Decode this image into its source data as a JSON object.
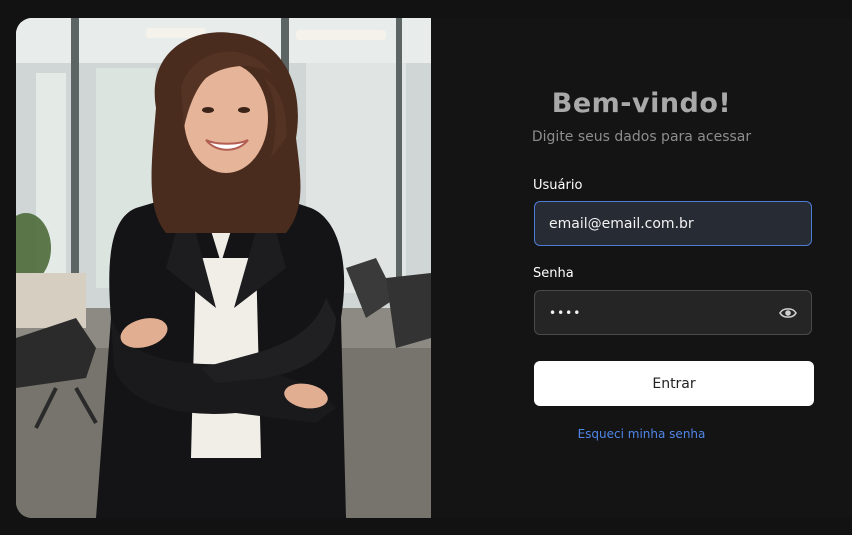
{
  "login": {
    "title": "Bem-vindo!",
    "subtitle": "Digite seus dados para acessar",
    "username_label": "Usuário",
    "username_value": "email@email.com.br",
    "password_label": "Senha",
    "password_value": "••••",
    "password_toggle_icon": "eye-icon",
    "submit_label": "Entrar",
    "forgot_label": "Esqueci minha senha"
  },
  "colors": {
    "accent": "#4f86e8",
    "background": "#141414",
    "input_background": "#252525",
    "button_background": "#ffffff"
  }
}
